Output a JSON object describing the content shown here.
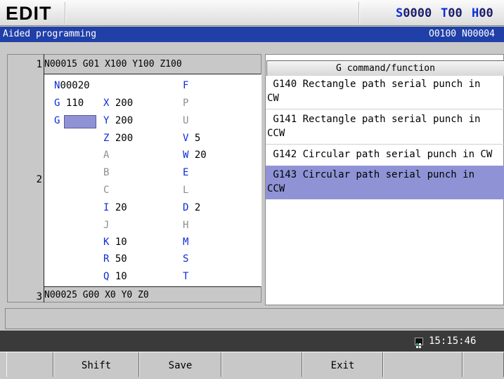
{
  "header": {
    "mode": "EDIT",
    "spindle": {
      "key": "S",
      "value": "0000"
    },
    "tool": {
      "key": "T",
      "value": "00"
    },
    "h_offset": {
      "key": "H",
      "value": "00"
    }
  },
  "titlebar": {
    "title": "Aided programming",
    "program": "O0100 N00004"
  },
  "editor": {
    "line_numbers": [
      "1",
      "2",
      "3"
    ],
    "prev_line": "N00015 G01 X100 Y100 Z100",
    "next_line": "N00025 G00 X0 Y0 Z0",
    "block": {
      "N": {
        "letter": "N",
        "value": "00020"
      },
      "G1": {
        "letter": "G",
        "value": "110"
      },
      "G2": {
        "letter": "G",
        "value": ""
      },
      "X": {
        "letter": "X",
        "value": "200"
      },
      "Y": {
        "letter": "Y",
        "value": "200"
      },
      "Z": {
        "letter": "Z",
        "value": "200"
      },
      "A": {
        "letter": "A",
        "value": ""
      },
      "B": {
        "letter": "B",
        "value": ""
      },
      "C": {
        "letter": "C",
        "value": ""
      },
      "I": {
        "letter": "I",
        "value": "20"
      },
      "J": {
        "letter": "J",
        "value": ""
      },
      "K": {
        "letter": "K",
        "value": "10"
      },
      "R": {
        "letter": "R",
        "value": "50"
      },
      "Q": {
        "letter": "Q",
        "value": "10"
      },
      "F": {
        "letter": "F",
        "value": ""
      },
      "P": {
        "letter": "P",
        "value": ""
      },
      "U": {
        "letter": "U",
        "value": ""
      },
      "V": {
        "letter": "V",
        "value": "5"
      },
      "W": {
        "letter": "W",
        "value": "20"
      },
      "E": {
        "letter": "E",
        "value": ""
      },
      "L": {
        "letter": "L",
        "value": ""
      },
      "D": {
        "letter": "D",
        "value": "2"
      },
      "H": {
        "letter": "H",
        "value": ""
      },
      "M": {
        "letter": "M",
        "value": ""
      },
      "S": {
        "letter": "S",
        "value": ""
      },
      "T": {
        "letter": "T",
        "value": ""
      }
    }
  },
  "gcommands": {
    "header": "G command/function",
    "items": [
      {
        "text": " G140 Rectangle path serial punch in\nCW"
      },
      {
        "text": " G141 Rectangle path serial punch in\nCCW"
      },
      {
        "text": " G142 Circular path serial punch in CW"
      },
      {
        "text": " G143 Circular path serial punch in\nCCW"
      }
    ],
    "selected_index": 3
  },
  "status": {
    "clock": "15:15:46"
  },
  "softkeys": [
    "",
    "Shift",
    "Save",
    "",
    "Exit",
    "",
    ""
  ],
  "colors": {
    "titlebar": "#2040a8",
    "accent_letter": "#0b2bd8",
    "selection": "#8f93d6"
  }
}
